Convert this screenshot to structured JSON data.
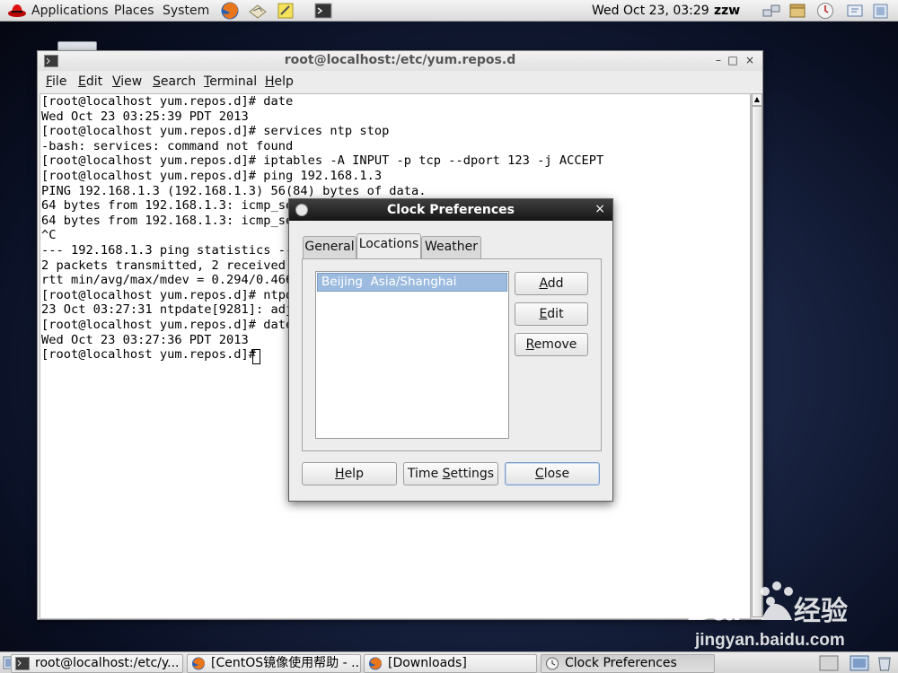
{
  "top_panel": {
    "menus": [
      "Applications",
      "Places",
      "System"
    ],
    "clock": "Wed Oct 23, 03:29",
    "user": "zzw"
  },
  "terminal": {
    "title": "root@localhost:/etc/yum.repos.d",
    "menu": [
      "File",
      "Edit",
      "View",
      "Search",
      "Terminal",
      "Help"
    ],
    "lines": [
      "[root@localhost yum.repos.d]# date",
      "Wed Oct 23 03:25:39 PDT 2013",
      "[root@localhost yum.repos.d]# services ntp stop",
      "-bash: services: command not found",
      "[root@localhost yum.repos.d]# iptables -A INPUT -p tcp --dport 123 -j ACCEPT",
      "[root@localhost yum.repos.d]# ping 192.168.1.3",
      "PING 192.168.1.3 (192.168.1.3) 56(84) bytes of data.",
      "64 bytes from 192.168.1.3: icmp_seq=",
      "64 bytes from 192.168.1.3: icmp_seq=",
      "^C",
      "--- 192.168.1.3 ping statistics ---",
      "2 packets transmitted, 2 received, 0",
      "rtt min/avg/max/mdev = 0.294/0.466/0",
      "[root@localhost yum.repos.d]# ntpdat",
      "23 Oct 03:27:31 ntpdate[9281]: adjus",
      "[root@localhost yum.repos.d]# date",
      "Wed Oct 23 03:27:36 PDT 2013",
      "[root@localhost yum.repos.d]# "
    ]
  },
  "clock_dialog": {
    "title": "Clock Preferences",
    "close_glyph": "×",
    "tabs": [
      "General",
      "Locations",
      "Weather"
    ],
    "active_tab": "Locations",
    "locations": [
      {
        "name": "Beijing",
        "timezone": "Asia/Shanghai"
      }
    ],
    "side_buttons": {
      "add": {
        "key": "A",
        "rest": "dd"
      },
      "edit": {
        "key": "E",
        "rest": "dit"
      },
      "remove": {
        "key": "R",
        "rest": "emove"
      }
    },
    "bottom_buttons": {
      "help": {
        "key": "H",
        "rest": "elp"
      },
      "time_settings": {
        "pre": "Time ",
        "key": "S",
        "rest": "ettings"
      },
      "close": {
        "key": "C",
        "rest": "lose"
      }
    }
  },
  "taskbar": {
    "items": [
      "root@localhost:/etc/y...",
      "[CentOS镜像使用帮助 - ...",
      "[Downloads]",
      "Clock Preferences"
    ],
    "active": "Clock Preferences"
  },
  "watermark": {
    "brand": "Bai",
    "brand_cn": "经验",
    "url": "jingyan.baidu.com"
  },
  "colors": {
    "selection": "#9cbbdf",
    "dialog_title_bg": "#161616",
    "desktop": "#1c2848"
  }
}
